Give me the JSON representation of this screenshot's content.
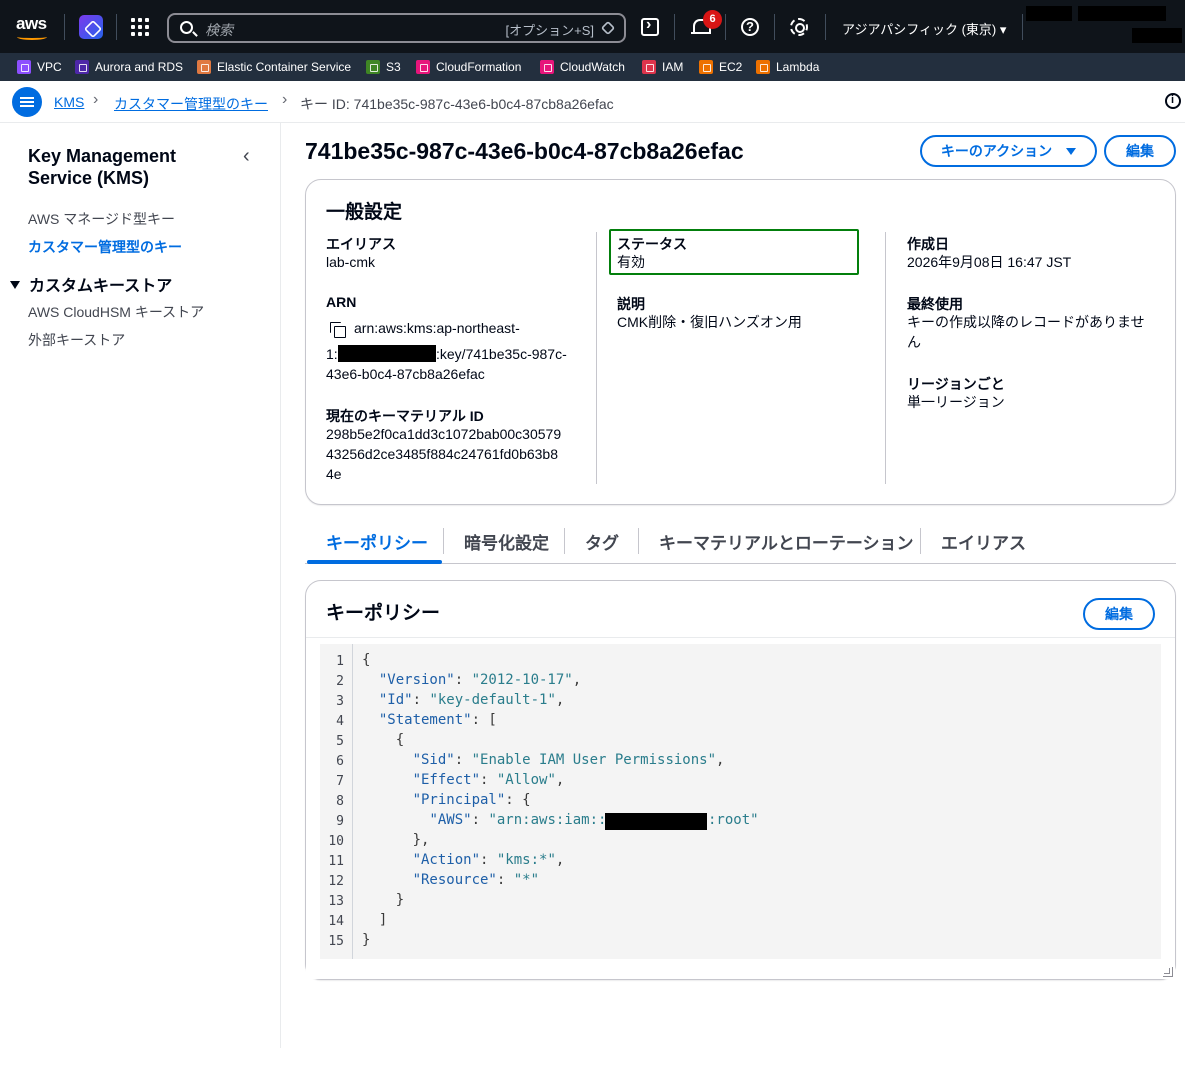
{
  "nav": {
    "logo": "aws",
    "search_placeholder": "検索",
    "search_shortcut": "[オプション+S]",
    "notifications_count": "6",
    "region": "アジアパシフィック (東京) ▾"
  },
  "favorites": [
    {
      "label": "VPC",
      "color": "#8c4fff"
    },
    {
      "label": "Aurora and RDS",
      "color": "#4d27a8"
    },
    {
      "label": "Elastic Container Service",
      "color": "#e07941"
    },
    {
      "label": "S3",
      "color": "#3f8624"
    },
    {
      "label": "CloudFormation",
      "color": "#e7157b"
    },
    {
      "label": "CloudWatch",
      "color": "#e7157b"
    },
    {
      "label": "IAM",
      "color": "#dd344c"
    },
    {
      "label": "EC2",
      "color": "#ed7100"
    },
    {
      "label": "Lambda",
      "color": "#ed7100"
    }
  ],
  "breadcrumb": {
    "kms": "KMS",
    "cmk": "カスタマー管理型のキー",
    "current": "キー ID: 741be35c-987c-43e6-b0c4-87cb8a26efac"
  },
  "sidenav": {
    "title": "Key Management Service (KMS)",
    "aws_managed": "AWS マネージド型キー",
    "customer_managed": "カスタマー管理型のキー",
    "custom_stores": "カスタムキーストア",
    "cloudhsm": "AWS CloudHSM キーストア",
    "external": "外部キーストア"
  },
  "page": {
    "title": "741be35c-987c-43e6-b0c4-87cb8a26efac",
    "key_actions": "キーのアクション",
    "edit": "編集"
  },
  "general": {
    "title": "一般設定",
    "alias_label": "エイリアス",
    "alias_value": "lab-cmk",
    "arn_label": "ARN",
    "arn_line1": "arn:aws:kms:ap-northeast-",
    "arn_line2_prefix": "1:",
    "arn_line2_suffix": ":key/741be35c-987c-",
    "arn_line3": "43e6-b0c4-87cb8a26efac",
    "material_label": "現在のキーマテリアル ID",
    "material_line1": "298b5e2f0ca1dd3c1072bab00c30579",
    "material_line2": "43256d2ce3485f884c24761fd0b63b8",
    "material_line3": "4e",
    "status_label": "ステータス",
    "status_value": "有効",
    "desc_label": "説明",
    "desc_value": "CMK削除・復旧ハンズオン用",
    "created_label": "作成日",
    "created_value": "2026年9月08日 16:47 JST",
    "lastused_label": "最終使用",
    "lastused_line1": "キーの作成以降のレコードがありませ",
    "lastused_line2": "ん",
    "region_label": "リージョンごと",
    "region_value": "単一リージョン"
  },
  "tabs": [
    "キーポリシー",
    "暗号化設定",
    "タグ",
    "キーマテリアルとローテーション",
    "エイリアス"
  ],
  "policy": {
    "title": "キーポリシー",
    "edit": "編集",
    "lines": [
      "{",
      "  \"Version\": \"2012-10-17\",",
      "  \"Id\": \"key-default-1\",",
      "  \"Statement\": [",
      "    {",
      "      \"Sid\": \"Enable IAM User Permissions\",",
      "      \"Effect\": \"Allow\",",
      "      \"Principal\": {",
      "        \"AWS\": \"arn:aws:iam::",
      "      },",
      "      \"Action\": \"kms:*\",",
      "      \"Resource\": \"*\"",
      "    }",
      "  ]",
      "}"
    ],
    "line9_suffix": ":root\""
  }
}
